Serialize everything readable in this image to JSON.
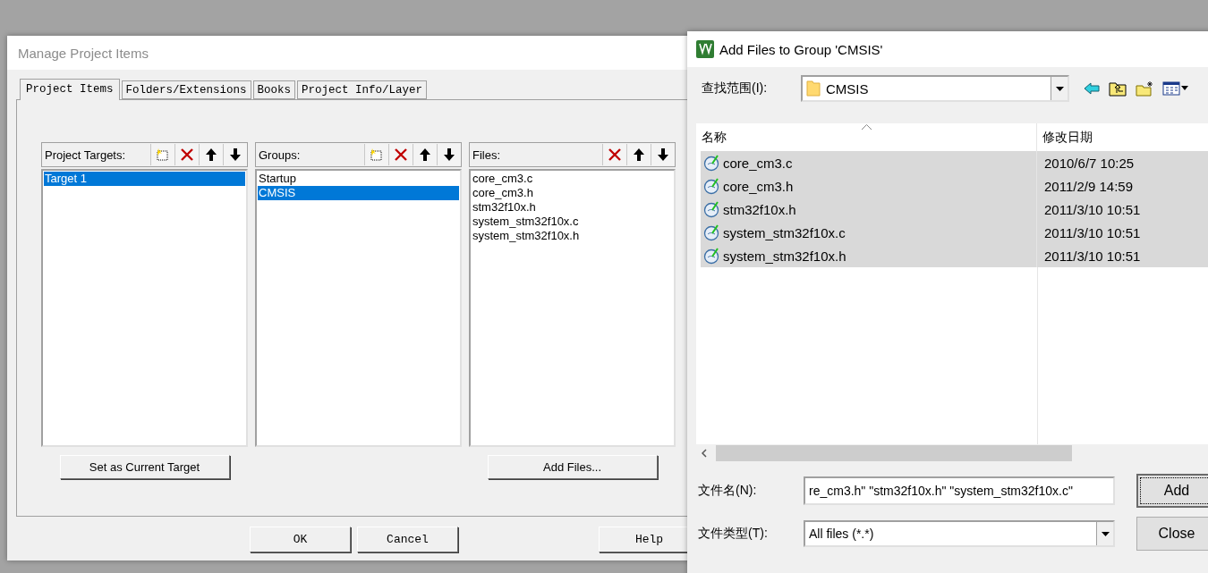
{
  "manage_dialog": {
    "title": "Manage Project Items",
    "tabs": [
      {
        "label": "Project Items",
        "selected": true
      },
      {
        "label": "Folders/Extensions",
        "selected": false
      },
      {
        "label": "Books",
        "selected": false
      },
      {
        "label": "Project Info/Layer",
        "selected": false
      }
    ],
    "panels": [
      {
        "label": "Project Targets:",
        "tools": [
          {
            "kind": "new"
          },
          {
            "kind": "delete"
          },
          {
            "kind": "up"
          },
          {
            "kind": "down"
          }
        ],
        "items": [
          {
            "label": "Target 1",
            "selected": true
          }
        ],
        "button": "Set as Current Target"
      },
      {
        "label": "Groups:",
        "tools": [
          {
            "kind": "new"
          },
          {
            "kind": "delete"
          },
          {
            "kind": "up"
          },
          {
            "kind": "down"
          }
        ],
        "items": [
          {
            "label": "Startup",
            "selected": false
          },
          {
            "label": "CMSIS",
            "selected": true
          }
        ]
      },
      {
        "label": "Files:",
        "tools": [
          {
            "kind": "delete"
          },
          {
            "kind": "up"
          },
          {
            "kind": "down"
          }
        ],
        "items": [
          {
            "label": "core_cm3.c",
            "selected": false
          },
          {
            "label": "core_cm3.h",
            "selected": false
          },
          {
            "label": "stm32f10x.h",
            "selected": false
          },
          {
            "label": "system_stm32f10x.c",
            "selected": false
          },
          {
            "label": "system_stm32f10x.h",
            "selected": false
          }
        ],
        "button": "Add Files..."
      }
    ],
    "buttons": [
      "OK",
      "Cancel",
      "Help"
    ]
  },
  "add_dialog": {
    "title": "Add Files to Group 'CMSIS'",
    "look_in": {
      "label": "查找范围(I):",
      "value": "CMSIS"
    },
    "columns": [
      "名称",
      "修改日期"
    ],
    "files": [
      {
        "name": "core_cm3.c",
        "date": "2010/6/7 10:25",
        "selected": true
      },
      {
        "name": "core_cm3.h",
        "date": "2011/2/9 14:59",
        "selected": true
      },
      {
        "name": "stm32f10x.h",
        "date": "2011/3/10 10:51",
        "selected": true
      },
      {
        "name": "system_stm32f10x.c",
        "date": "2011/3/10 10:51",
        "selected": true
      },
      {
        "name": "system_stm32f10x.h",
        "date": "2011/3/10 10:51",
        "selected": true
      }
    ],
    "file_name": {
      "label": "文件名(N):",
      "value": "re_cm3.h\" \"stm32f10x.h\" \"system_stm32f10x.c\""
    },
    "file_type": {
      "label": "文件类型(T):",
      "value": "All files (*.*)"
    },
    "buttons": [
      {
        "label": "Add",
        "default": true
      },
      {
        "label": "Close",
        "default": false
      }
    ]
  }
}
